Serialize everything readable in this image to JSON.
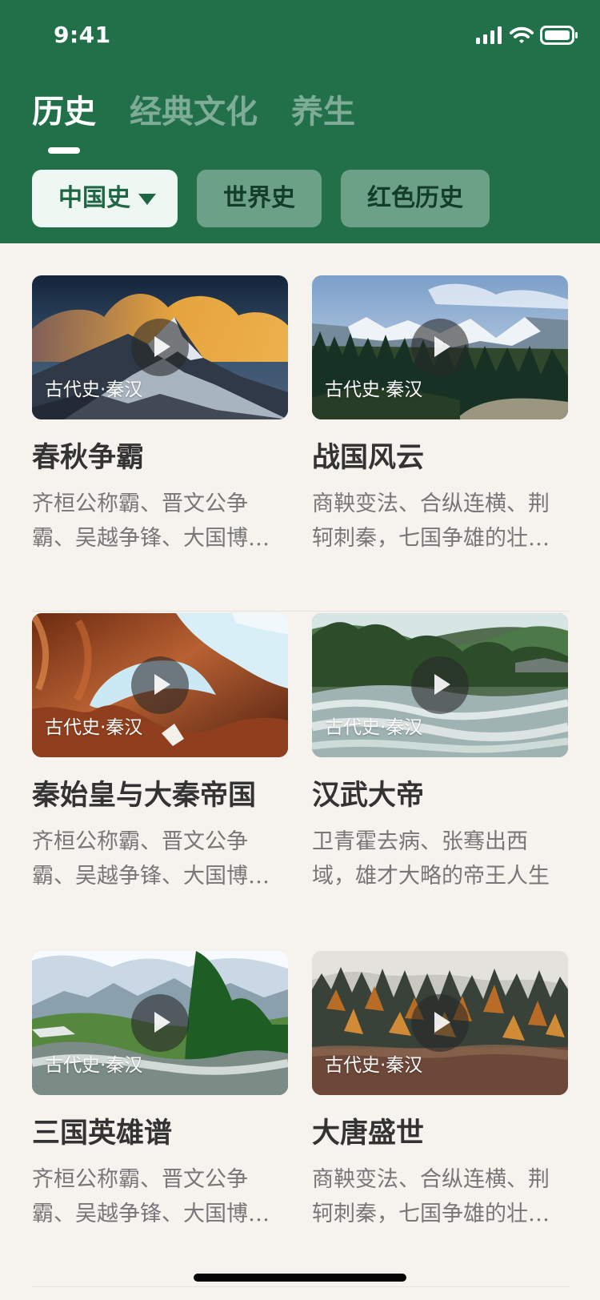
{
  "status_bar": {
    "time": "9:41"
  },
  "tabs": [
    {
      "label": "历史",
      "active": true
    },
    {
      "label": "经典文化",
      "active": false
    },
    {
      "label": "养生",
      "active": false
    }
  ],
  "filters": [
    {
      "label": "中国史",
      "active": true
    },
    {
      "label": "世界史",
      "active": false
    },
    {
      "label": "红色历史",
      "active": false
    }
  ],
  "cards": [
    {
      "badge": "古代史·秦汉",
      "title": "春秋争霸",
      "description": "齐桓公称霸、晋文公争霸、吴越争锋、大国博…",
      "image": "sunset-mountain"
    },
    {
      "badge": "古代史·秦汉",
      "title": "战国风云",
      "description": "商鞅变法、合纵连横、荆轲刺秦，七国争雄的壮…",
      "image": "snow-peaks-forest"
    },
    {
      "badge": "古代史·秦汉",
      "title": "秦始皇与大秦帝国",
      "description": "齐桓公称霸、晋文公争霸、吴越争锋、大国博…",
      "image": "red-rock-arch"
    },
    {
      "badge": "古代史·秦汉",
      "title": "汉武大帝",
      "description": "卫青霍去病、张骞出西域，雄才大略的帝王人生",
      "image": "river-rapids"
    },
    {
      "badge": "古代史·秦汉",
      "title": "三国英雄谱",
      "description": "齐桓公称霸、晋文公争霸、吴越争锋、大国博…",
      "image": "alpine-river"
    },
    {
      "badge": "古代史·秦汉",
      "title": "大唐盛世",
      "description": "商鞅变法、合纵连横、荆轲刺秦，七国争雄的壮…",
      "image": "autumn-forest"
    }
  ],
  "colors": {
    "header": "#21704a",
    "background": "#f6f3ef",
    "accent": "#1f6644"
  }
}
